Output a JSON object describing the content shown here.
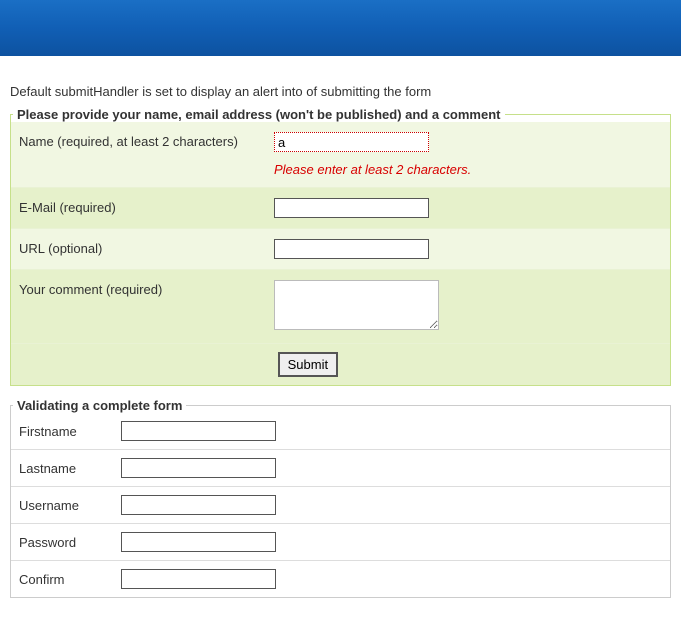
{
  "intro": "Default submitHandler is set to display an alert into of submitting the form",
  "form1": {
    "legend": "Please provide your name, email address (won't be published) and a comment",
    "name": {
      "label": "Name (required, at least 2 characters)",
      "value": "a",
      "error": "Please enter at least 2 characters."
    },
    "email": {
      "label": "E-Mail (required)",
      "value": ""
    },
    "url": {
      "label": "URL (optional)",
      "value": ""
    },
    "comment": {
      "label": "Your comment (required)",
      "value": ""
    },
    "submit": "Submit"
  },
  "form2": {
    "legend": "Validating a complete form",
    "firstname": {
      "label": "Firstname",
      "value": ""
    },
    "lastname": {
      "label": "Lastname",
      "value": ""
    },
    "username": {
      "label": "Username",
      "value": ""
    },
    "password": {
      "label": "Password",
      "value": ""
    },
    "confirm": {
      "label": "Confirm",
      "value": ""
    }
  }
}
